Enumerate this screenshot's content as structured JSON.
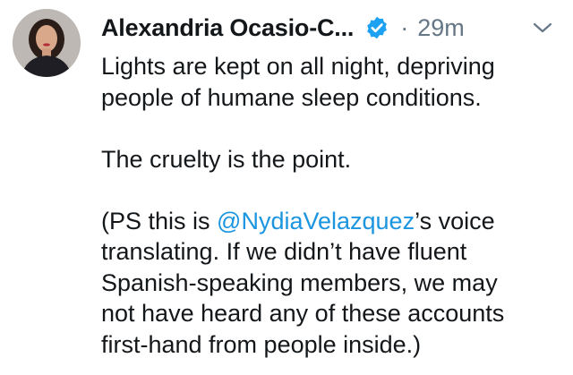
{
  "tweet": {
    "author_name": "Alexandria Ocasio-C...",
    "separator": "·",
    "timestamp": "29m",
    "paragraph_1": "Lights are kept on all night, depriving\npeople of humane sleep conditions.",
    "paragraph_2": "The cruelty is the point.",
    "paragraph_3_prefix": "(PS this is ",
    "paragraph_3_mention": "@NydiaVelazquez",
    "paragraph_3_suffix": "’s voice\ntranslating. If we didn’t have fluent\nSpanish-speaking members, we may\nnot have heard any of these accounts\nfirst-hand from people inside.)",
    "icons": {
      "avatar": "profile-photo",
      "verified": "verified-badge-icon",
      "menu": "chevron-down-icon"
    }
  },
  "colors": {
    "text": "#14171a",
    "secondary": "#657786",
    "link": "#1b95e0",
    "verified_blue": "#1da1f2"
  }
}
